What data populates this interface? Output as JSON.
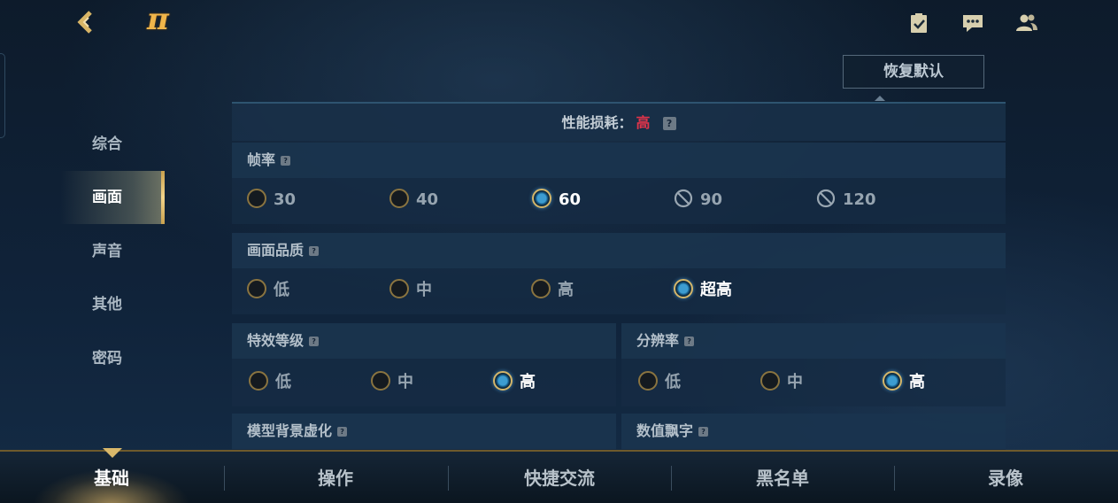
{
  "header": {
    "back_label": "",
    "logo_text": "π",
    "icons": [
      "clipboard-check-icon",
      "chat-icon",
      "friends-icon"
    ]
  },
  "reset_button": "恢复默认",
  "sidebar": {
    "items": [
      {
        "label": "综合",
        "active": false
      },
      {
        "label": "画面",
        "active": true
      },
      {
        "label": "声音",
        "active": false
      },
      {
        "label": "其他",
        "active": false
      },
      {
        "label": "密码",
        "active": false
      }
    ]
  },
  "performance": {
    "label": "性能损耗：",
    "value": "高",
    "help": "?"
  },
  "sections": {
    "frame_rate": {
      "title": "帧率",
      "options": [
        {
          "label": "30",
          "state": "off"
        },
        {
          "label": "40",
          "state": "off"
        },
        {
          "label": "60",
          "state": "on"
        },
        {
          "label": "90",
          "state": "disabled"
        },
        {
          "label": "120",
          "state": "disabled"
        }
      ]
    },
    "image_quality": {
      "title": "画面品质",
      "options": [
        {
          "label": "低",
          "state": "off"
        },
        {
          "label": "中",
          "state": "off"
        },
        {
          "label": "高",
          "state": "off"
        },
        {
          "label": "超高",
          "state": "on"
        }
      ]
    },
    "effects_level": {
      "title": "特效等级",
      "options": [
        {
          "label": "低",
          "state": "off"
        },
        {
          "label": "中",
          "state": "off"
        },
        {
          "label": "高",
          "state": "on"
        }
      ]
    },
    "resolution": {
      "title": "分辨率",
      "options": [
        {
          "label": "低",
          "state": "off"
        },
        {
          "label": "中",
          "state": "off"
        },
        {
          "label": "高",
          "state": "on"
        }
      ]
    },
    "model_bg_blur": {
      "title": "模型背景虚化"
    },
    "damage_numbers": {
      "title": "数值飘字"
    }
  },
  "tabs": [
    {
      "label": "基础",
      "active": true
    },
    {
      "label": "操作",
      "active": false
    },
    {
      "label": "快捷交流",
      "active": false
    },
    {
      "label": "黑名单",
      "active": false
    },
    {
      "label": "录像",
      "active": false
    }
  ],
  "colors": {
    "accent_gold": "#d9b86a",
    "perf_high_red": "#e0344a",
    "selected_blue": "#3d9cd0"
  }
}
